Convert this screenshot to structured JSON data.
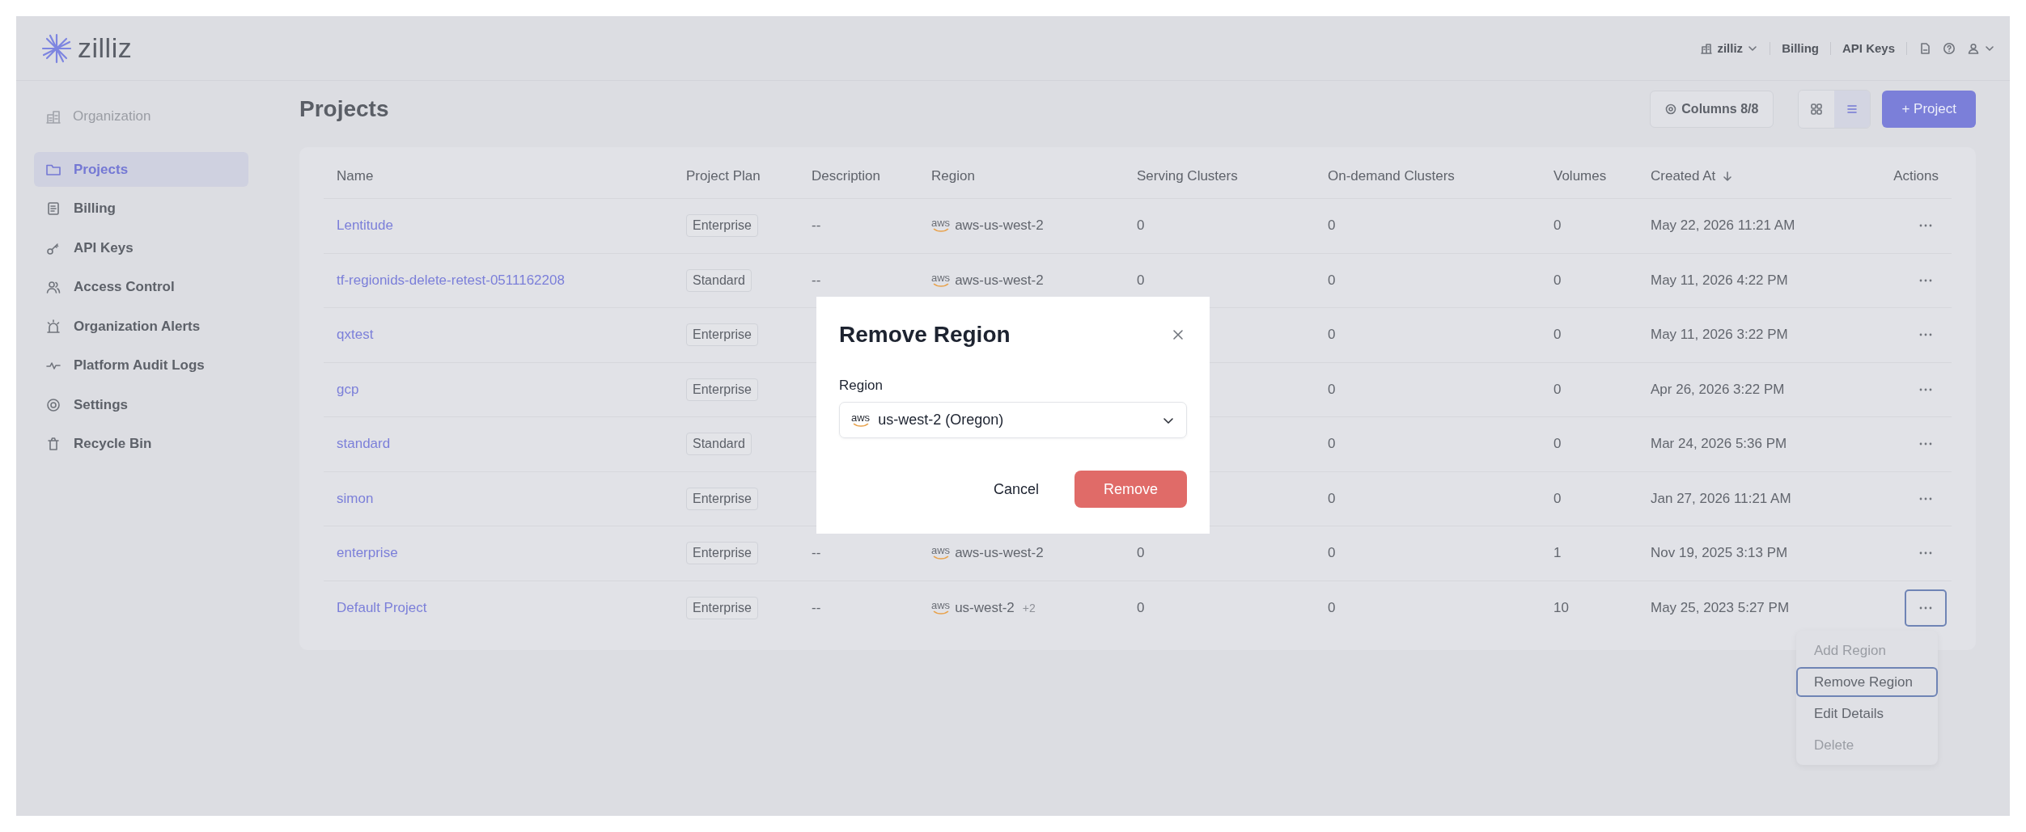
{
  "header": {
    "logo_text": "zilliz",
    "org_switcher": "zilliz",
    "links": [
      "Billing",
      "API Keys"
    ]
  },
  "sidebar": {
    "heading": "Organization",
    "items": [
      {
        "label": "Projects",
        "selected": true
      },
      {
        "label": "Billing",
        "selected": false
      },
      {
        "label": "API Keys",
        "selected": false
      },
      {
        "label": "Access Control",
        "selected": false
      },
      {
        "label": "Organization Alerts",
        "selected": false
      },
      {
        "label": "Platform Audit Logs",
        "selected": false
      },
      {
        "label": "Settings",
        "selected": false
      },
      {
        "label": "Recycle Bin",
        "selected": false
      }
    ]
  },
  "page_title": "Projects",
  "toolbar": {
    "columns_button": "Columns 8/8",
    "view_toggle": [
      {
        "kind": "grid",
        "selected": false
      },
      {
        "kind": "list",
        "selected": true
      }
    ],
    "add_button": "+ Project"
  },
  "table": {
    "columns": [
      {
        "label": "Name"
      },
      {
        "label": "Project Plan"
      },
      {
        "label": "Description"
      },
      {
        "label": "Region"
      },
      {
        "label": "Serving Clusters"
      },
      {
        "label": "On-demand Clusters"
      },
      {
        "label": "Volumes"
      },
      {
        "label": "Created At",
        "sorted_descending": true
      },
      {
        "label": "Actions"
      }
    ],
    "rows": [
      {
        "name": "Lentitude",
        "plan": "Enterprise",
        "description": "--",
        "region_logo": "aws",
        "region": "aws-us-west-2",
        "serving": "0",
        "on_demand": "0",
        "volumes": "0",
        "created_at": "May 22, 2026 11:21 AM",
        "menu_open": false
      },
      {
        "name": "tf-regionids-delete-retest-0511162208",
        "plan": "Standard",
        "description": "--",
        "region_logo": "aws",
        "region": "aws-us-west-2",
        "serving": "0",
        "on_demand": "0",
        "volumes": "0",
        "created_at": "May 11, 2026 4:22 PM",
        "menu_open": false
      },
      {
        "name": "qxtest",
        "plan": "Enterprise",
        "on_demand": "0",
        "volumes": "0",
        "created_at": "May 11, 2026 3:22 PM",
        "menu_open": false
      },
      {
        "name": "gcp",
        "plan": "Enterprise",
        "on_demand": "0",
        "volumes": "0",
        "created_at": "Apr 26, 2026 3:22 PM",
        "menu_open": false
      },
      {
        "name": "standard",
        "plan": "Standard",
        "on_demand": "0",
        "volumes": "0",
        "created_at": "Mar 24, 2026 5:36 PM",
        "menu_open": false
      },
      {
        "name": "simon",
        "plan": "Enterprise",
        "on_demand": "0",
        "volumes": "0",
        "created_at": "Jan 27, 2026 11:21 AM",
        "menu_open": false
      },
      {
        "name": "enterprise",
        "plan": "Enterprise",
        "description": "--",
        "region_logo": "aws",
        "region": "aws-us-west-2",
        "serving": "0",
        "on_demand": "0",
        "volumes": "1",
        "created_at": "Nov 19, 2025 3:13 PM",
        "menu_open": false
      },
      {
        "name": "Default Project",
        "plan": "Enterprise",
        "description": "--",
        "region_logo": "aws",
        "region": "us-west-2",
        "region_extra": "+2",
        "serving": "0",
        "on_demand": "0",
        "volumes": "10",
        "created_at": "May 25, 2023 5:27 PM",
        "menu_open": true
      }
    ]
  },
  "menu": {
    "items": [
      {
        "label": "Add Region",
        "disabled": true,
        "selected": false
      },
      {
        "label": "Remove Region",
        "disabled": false,
        "selected": true
      },
      {
        "label": "Edit Details",
        "disabled": false,
        "selected": false
      },
      {
        "label": "Delete",
        "disabled": true,
        "selected": false
      }
    ]
  },
  "dialog": {
    "title": "Remove Region",
    "field_label": "Region",
    "select": {
      "logo": "aws",
      "value": "us-west-2 (Oregon)"
    },
    "buttons": [
      {
        "label": "Cancel",
        "kind": "secondary"
      },
      {
        "label": "Remove",
        "kind": "danger"
      }
    ]
  }
}
